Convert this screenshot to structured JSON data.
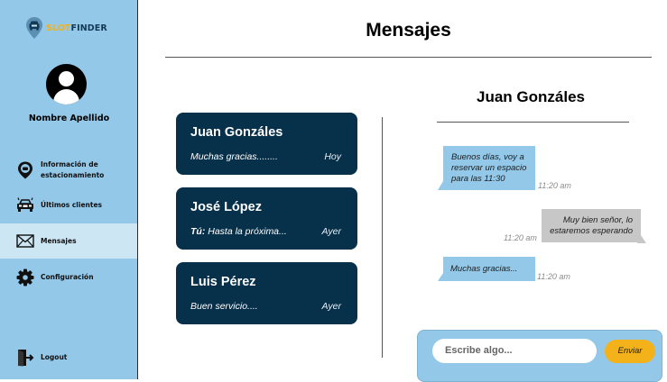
{
  "app": {
    "logo_slot": "SLOT",
    "logo_finder": "FINDER",
    "user_name": "Nombre Apellido"
  },
  "sidebar": {
    "items": [
      {
        "icon": "parking-pin-icon",
        "label_line1": "Información de",
        "label_line2": "estacionamiento"
      },
      {
        "icon": "car-icon",
        "label": "Últimos clientes"
      },
      {
        "icon": "mail-icon",
        "label": "Mensajes",
        "active": true
      },
      {
        "icon": "gear-icon",
        "label": "Configuración"
      }
    ],
    "logout_label": "Logout"
  },
  "page": {
    "title": "Mensajes"
  },
  "conversations": [
    {
      "name": "Juan Gonzáles",
      "preview": "Muchas gracias........",
      "time": "Hoy"
    },
    {
      "name": "José López",
      "preview_prefix": "Tú:",
      "preview": " Hasta la próxima...",
      "time": "Ayer"
    },
    {
      "name": "Luis Pérez",
      "preview": "Buen servicio....",
      "time": "Ayer"
    }
  ],
  "chat": {
    "contact": "Juan Gonzáles",
    "messages": [
      {
        "direction": "in",
        "line1": "Buenos días, voy a",
        "line2": "reservar un espacio",
        "line3": "para las 11:30",
        "time": "11:20 am"
      },
      {
        "direction": "out",
        "line1": "Muy bien señor, lo",
        "line2": "estaremos esperando",
        "time": "11:20 am"
      },
      {
        "direction": "in",
        "line1": "Muchas gracias...",
        "time": "11:20 am"
      }
    ],
    "input_placeholder": "Escribe algo...",
    "send_label": "Enviar"
  },
  "colors": {
    "sidebar_bg": "#93c8e8",
    "card_bg": "#07304b",
    "accent": "#f3b21a",
    "outgoing_bubble": "#c7c7c7"
  }
}
